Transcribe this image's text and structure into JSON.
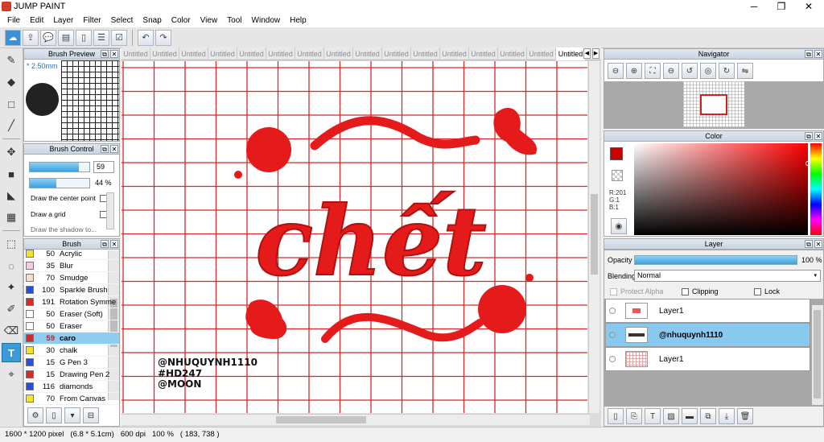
{
  "window": {
    "title": "JUMP PAINT",
    "minimize": "─",
    "maximize": "❐",
    "close": "✕"
  },
  "menu": [
    "File",
    "Edit",
    "Layer",
    "Filter",
    "Select",
    "Snap",
    "Color",
    "View",
    "Tool",
    "Window",
    "Help"
  ],
  "panels": {
    "brush_preview": {
      "title": "Brush Preview",
      "size": "* 2.50mm"
    },
    "brush_control": {
      "title": "Brush Control",
      "size_value": "59",
      "opacity_value": "44 %",
      "size_fill": 0.82,
      "opacity_fill": 0.44,
      "options": [
        "Draw the center point",
        "Draw a grid",
        "Draw the shadow to..."
      ]
    },
    "brush": {
      "title": "Brush",
      "items": [
        {
          "size": "50",
          "name": "Acrylic",
          "color": "#f3e22a"
        },
        {
          "size": "35",
          "name": "Blur",
          "color": "#f6c9e4"
        },
        {
          "size": "70",
          "name": "Smudge",
          "color": "#f5dfc2"
        },
        {
          "size": "100",
          "name": "Sparkle Brush",
          "color": "#2a4fd2"
        },
        {
          "size": "191",
          "name": "Rotation Symme",
          "color": "#d12b2b"
        },
        {
          "size": "50",
          "name": "Eraser (Soft)",
          "color": "#ffffff"
        },
        {
          "size": "50",
          "name": "Eraser",
          "color": "#ffffff"
        },
        {
          "size": "59",
          "name": "caro",
          "color": "#d12b2b"
        },
        {
          "size": "30",
          "name": "chalk",
          "color": "#f3e22a"
        },
        {
          "size": "15",
          "name": "G Pen 3",
          "color": "#2a4fd2"
        },
        {
          "size": "15",
          "name": "Drawing Pen 2",
          "color": "#d12b2b"
        },
        {
          "size": "116",
          "name": "diamonds",
          "color": "#2a4fd2"
        },
        {
          "size": "70",
          "name": "From Canvas",
          "color": "#f3e22a"
        }
      ]
    },
    "navigator": {
      "title": "Navigator"
    },
    "color": {
      "title": "Color",
      "r": "R:201",
      "g": "G:1",
      "b": "B:1",
      "current": "#c90101"
    },
    "layer": {
      "title": "Layer",
      "opacity_label": "Opacity",
      "opacity_value": "100 %",
      "opacity_fill": 1.0,
      "blending_label": "Blending",
      "blending_value": "Normal",
      "protect_alpha": "Protect Alpha",
      "clipping": "Clipping",
      "lock": "Lock",
      "layers": [
        {
          "name": "Layer1",
          "selected": false
        },
        {
          "name": "@nhuquynh1110",
          "selected": true
        },
        {
          "name": "Layer1",
          "selected": false
        }
      ]
    }
  },
  "tabs": [
    "Untitled",
    "Untitled",
    "Untitled",
    "Untitled",
    "Untitled",
    "Untitled",
    "Untitled",
    "Untitled",
    "Untitled",
    "Untitled",
    "Untitled",
    "Untitled",
    "Untitled",
    "Untitled",
    "Untitled",
    "Untitled"
  ],
  "canvas": {
    "main_text": "chết",
    "watermark": [
      "@NHUQUYNH1110",
      "#HD247",
      "@MOON"
    ],
    "ink_color": "#e51b1b",
    "grid_color": "#d42a2a"
  },
  "status": {
    "pixels": "1600 * 1200 pixel",
    "size": "(6.8 * 5.1cm)",
    "dpi": "600 dpi",
    "zoom": "100 %",
    "coords": "( 183, 738 )"
  }
}
